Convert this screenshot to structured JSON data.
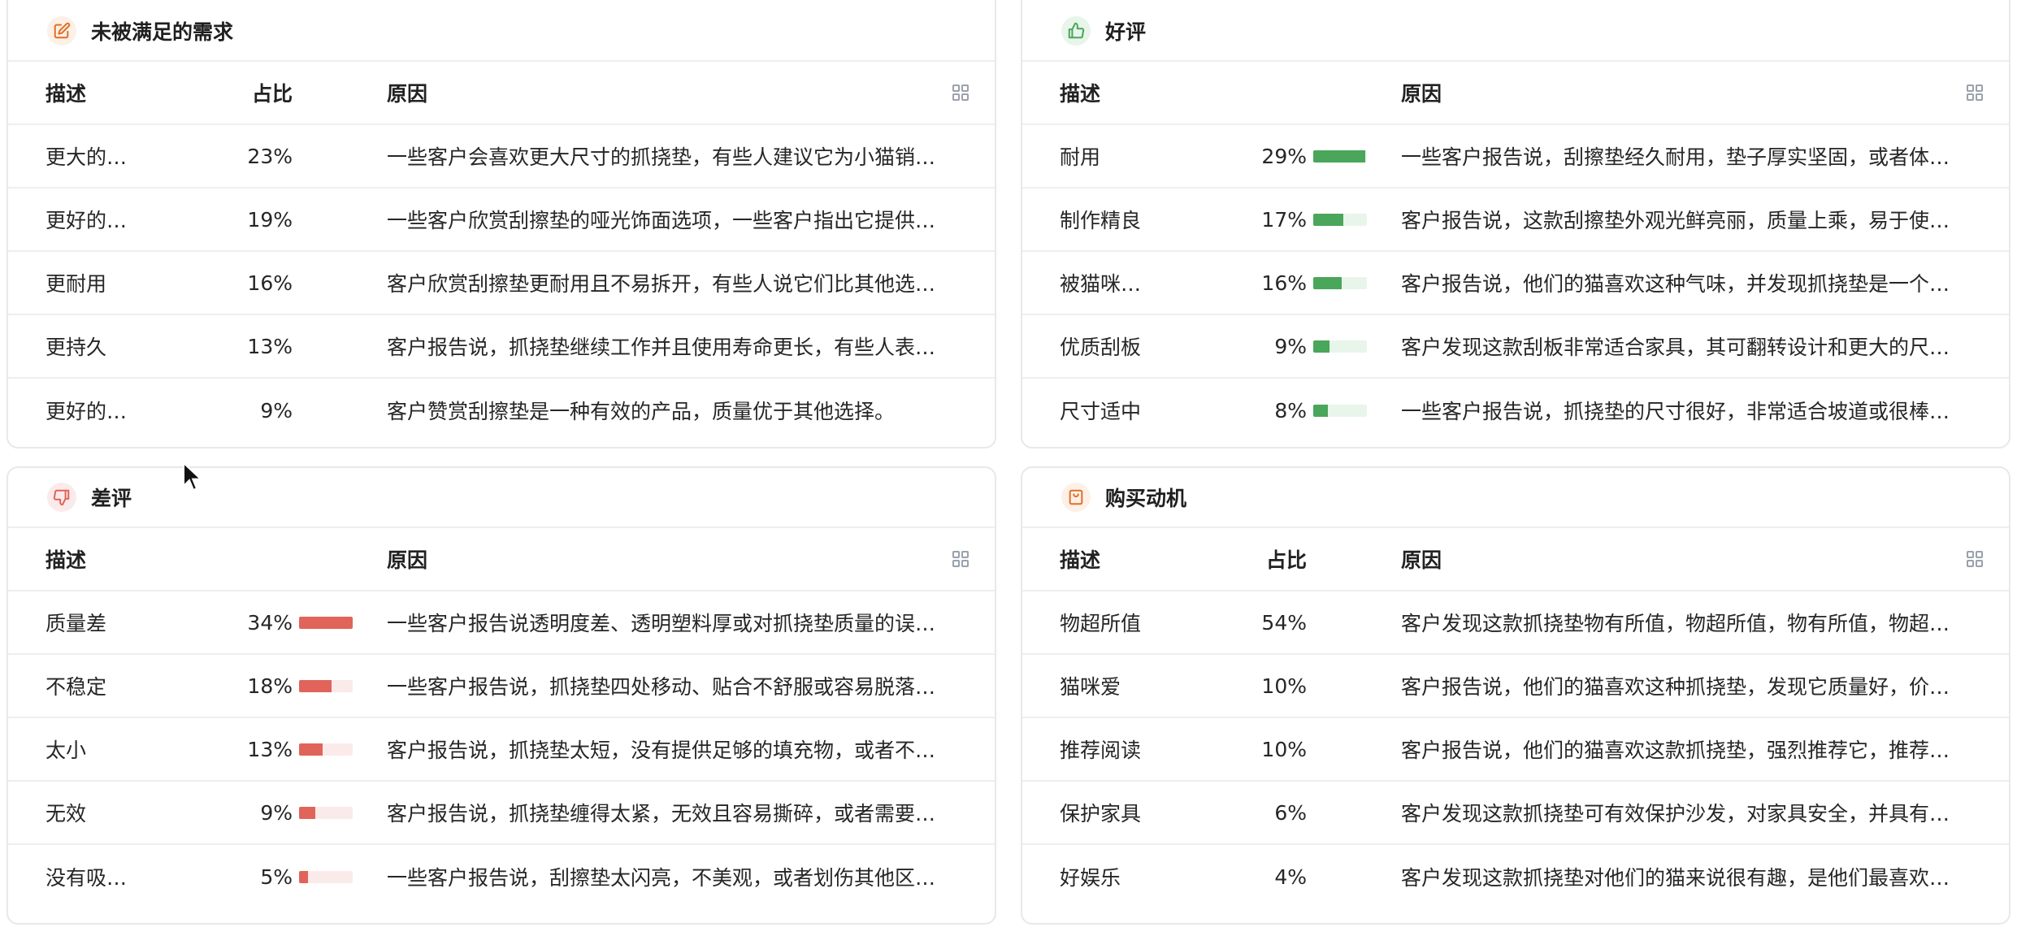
{
  "headers": {
    "desc": "描述",
    "share": "占比",
    "reason": "原因"
  },
  "colors": {
    "green": "#4aa65a",
    "green_bg": "#e8f5ea",
    "red": "#e0645a",
    "red_bg": "#fbeaea",
    "orange": "#e0702a",
    "icon_gray": "#9aa1ab"
  },
  "unmet": {
    "title": "未被满足的需求",
    "icon": "edit-icon",
    "rows": [
      {
        "desc": "更大的…",
        "pct": "23%",
        "reason": "一些客户会喜欢更大尺寸的抓挠垫，有些人建议它为小猫销…"
      },
      {
        "desc": "更好的…",
        "pct": "19%",
        "reason": "一些客户欣赏刮擦垫的哑光饰面选项，一些客户指出它提供…"
      },
      {
        "desc": "更耐用",
        "pct": "16%",
        "reason": "客户欣赏刮擦垫更耐用且不易拆开，有些人说它们比其他选…"
      },
      {
        "desc": "更持久",
        "pct": "13%",
        "reason": "客户报告说，抓挠垫继续工作并且使用寿命更长，有些人表…"
      },
      {
        "desc": "更好的…",
        "pct": "9%",
        "reason": "客户赞赏刮擦垫是一种有效的产品，质量优于其他选择。"
      }
    ]
  },
  "good": {
    "title": "好评",
    "icon": "thumbs-up-icon",
    "rows": [
      {
        "desc": "耐用",
        "pct": "29%",
        "level": 29,
        "reason": "一些客户报告说，刮擦垫经久耐用，垫子厚实坚固，或者体…"
      },
      {
        "desc": "制作精良",
        "pct": "17%",
        "level": 17,
        "reason": "客户报告说，这款刮擦垫外观光鲜亮丽，质量上乘，易于使…"
      },
      {
        "desc": "被猫咪…",
        "pct": "16%",
        "level": 16,
        "reason": "客户报告说，他们的猫喜欢这种气味，并发现抓挠垫是一个…"
      },
      {
        "desc": "优质刮板",
        "pct": "9%",
        "level": 9,
        "reason": "客户发现这款刮板非常适合家具，其可翻转设计和更大的尺…"
      },
      {
        "desc": "尺寸适中",
        "pct": "8%",
        "level": 8,
        "reason": "一些客户报告说，抓挠垫的尺寸很好，非常适合坡道或很棒…"
      }
    ]
  },
  "bad": {
    "title": "差评",
    "icon": "thumbs-down-icon",
    "rows": [
      {
        "desc": "质量差",
        "pct": "34%",
        "level": 34,
        "reason": "一些客户报告说透明度差、透明塑料厚或对抓挠垫质量的误…"
      },
      {
        "desc": "不稳定",
        "pct": "18%",
        "level": 18,
        "reason": "一些客户报告说，抓挠垫四处移动、贴合不舒服或容易脱落…"
      },
      {
        "desc": "太小",
        "pct": "13%",
        "level": 13,
        "reason": "客户报告说，抓挠垫太短，没有提供足够的填充物，或者不…"
      },
      {
        "desc": "无效",
        "pct": "9%",
        "level": 9,
        "reason": "客户报告说，抓挠垫缠得太紧，无效且容易撕碎，或者需要…"
      },
      {
        "desc": "没有吸…",
        "pct": "5%",
        "level": 5,
        "reason": "一些客户报告说，刮擦垫太闪亮，不美观，或者划伤其他区…"
      }
    ]
  },
  "motive": {
    "title": "购买动机",
    "icon": "shopping-bag-icon",
    "rows": [
      {
        "desc": "物超所值",
        "pct": "54%",
        "reason": "客户发现这款抓挠垫物有所值，物超所值，物有所值，物超…"
      },
      {
        "desc": "猫咪爱",
        "pct": "10%",
        "reason": "客户报告说，他们的猫喜欢这种抓挠垫，发现它质量好，价…"
      },
      {
        "desc": "推荐阅读",
        "pct": "10%",
        "reason": "客户报告说，他们的猫喜欢这款抓挠垫，强烈推荐它，推荐…"
      },
      {
        "desc": "保护家具",
        "pct": "6%",
        "reason": "客户发现这款抓挠垫可有效保护沙发，对家具安全，并具有…"
      },
      {
        "desc": "好娱乐",
        "pct": "4%",
        "reason": "客户发现这款抓挠垫对他们的猫来说很有趣，是他们最喜欢…"
      }
    ]
  }
}
